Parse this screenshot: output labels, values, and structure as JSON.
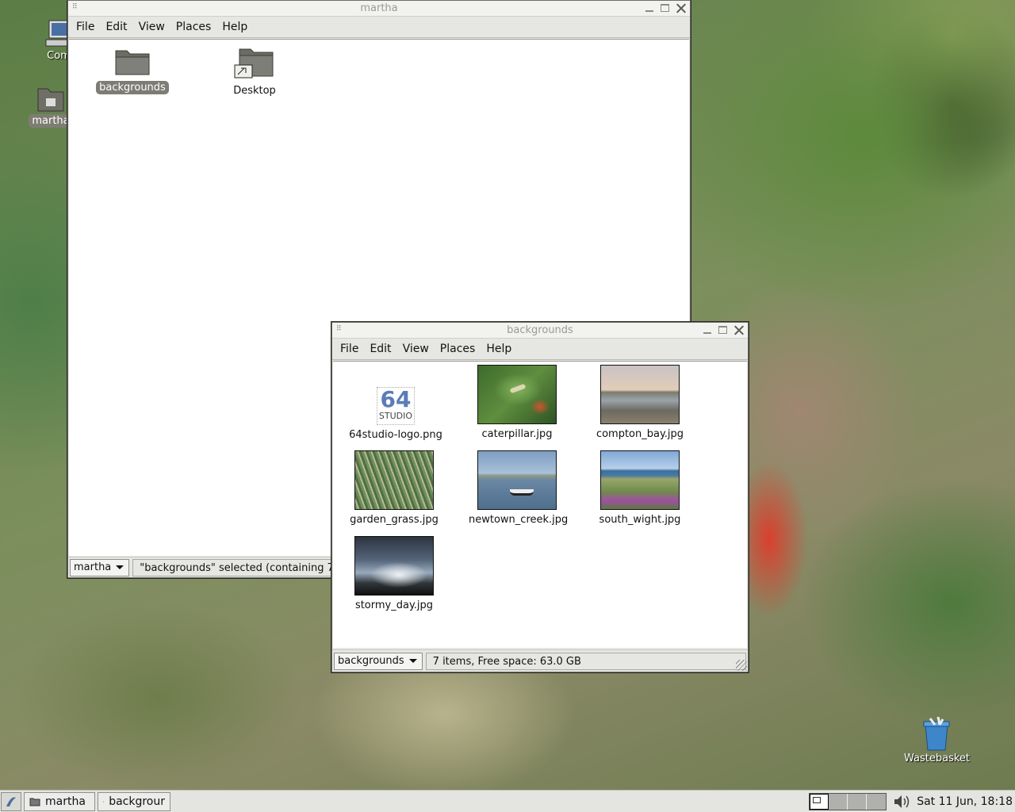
{
  "desktop": {
    "icons": [
      {
        "label": "Com"
      },
      {
        "label": "martha"
      }
    ],
    "wastebasket_label": "Wastebasket"
  },
  "martha_window": {
    "title": "martha",
    "menu": [
      "File",
      "Edit",
      "View",
      "Places",
      "Help"
    ],
    "items": [
      {
        "name": "backgrounds",
        "selected": true,
        "icon": "folder-icon"
      },
      {
        "name": "Desktop",
        "selected": false,
        "icon": "desktop-folder-icon"
      }
    ],
    "location": "martha",
    "status": "\"backgrounds\" selected (containing 7 it"
  },
  "backgrounds_window": {
    "title": "backgrounds",
    "menu": [
      "File",
      "Edit",
      "View",
      "Places",
      "Help"
    ],
    "files": [
      {
        "name": "64studio-logo.png",
        "kind": "logo",
        "logo_top": "64",
        "logo_bottom": "STUDIO"
      },
      {
        "name": "caterpillar.jpg",
        "kind": "caterpillar"
      },
      {
        "name": "compton_bay.jpg",
        "kind": "bay"
      },
      {
        "name": "garden_grass.jpg",
        "kind": "grass"
      },
      {
        "name": "newtown_creek.jpg",
        "kind": "creek"
      },
      {
        "name": "south_wight.jpg",
        "kind": "wight"
      },
      {
        "name": "stormy_day.jpg",
        "kind": "stormy"
      }
    ],
    "location": "backgrounds",
    "status": "7 items, Free space: 63.0 GB"
  },
  "taskbar": {
    "tasks": [
      "martha",
      "backgrour"
    ],
    "clock": "Sat 11 Jun, 18:18"
  }
}
